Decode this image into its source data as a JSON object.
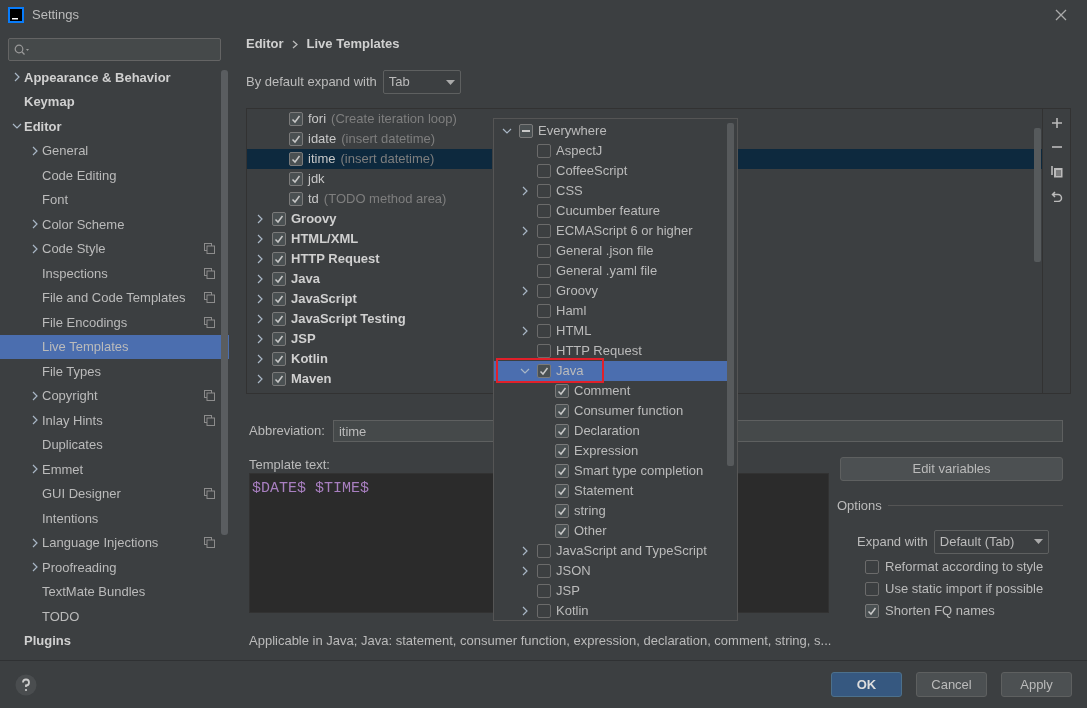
{
  "window": {
    "title": "Settings"
  },
  "sidebar": {
    "items": [
      {
        "label": "Appearance & Behavior",
        "kind": "group",
        "expanded": false,
        "selected": false,
        "project_icon": false
      },
      {
        "label": "Keymap",
        "kind": "page",
        "selected": false,
        "project_icon": false
      },
      {
        "label": "Editor",
        "kind": "group",
        "expanded": true,
        "selected": false,
        "project_icon": false,
        "children": [
          {
            "label": "General",
            "kind": "group",
            "expanded": false,
            "selected": false,
            "project_icon": false
          },
          {
            "label": "Code Editing",
            "kind": "page",
            "selected": false,
            "project_icon": false
          },
          {
            "label": "Font",
            "kind": "page",
            "selected": false,
            "project_icon": false
          },
          {
            "label": "Color Scheme",
            "kind": "group",
            "expanded": false,
            "selected": false,
            "project_icon": false
          },
          {
            "label": "Code Style",
            "kind": "group",
            "expanded": false,
            "selected": false,
            "project_icon": true
          },
          {
            "label": "Inspections",
            "kind": "page",
            "selected": false,
            "project_icon": true
          },
          {
            "label": "File and Code Templates",
            "kind": "page",
            "selected": false,
            "project_icon": true
          },
          {
            "label": "File Encodings",
            "kind": "page",
            "selected": false,
            "project_icon": true
          },
          {
            "label": "Live Templates",
            "kind": "page",
            "selected": true,
            "project_icon": false
          },
          {
            "label": "File Types",
            "kind": "page",
            "selected": false,
            "project_icon": false
          },
          {
            "label": "Copyright",
            "kind": "group",
            "expanded": false,
            "selected": false,
            "project_icon": true
          },
          {
            "label": "Inlay Hints",
            "kind": "group",
            "expanded": false,
            "selected": false,
            "project_icon": true
          },
          {
            "label": "Duplicates",
            "kind": "page",
            "selected": false,
            "project_icon": false
          },
          {
            "label": "Emmet",
            "kind": "group",
            "expanded": false,
            "selected": false,
            "project_icon": false
          },
          {
            "label": "GUI Designer",
            "kind": "page",
            "selected": false,
            "project_icon": true
          },
          {
            "label": "Intentions",
            "kind": "page",
            "selected": false,
            "project_icon": false
          },
          {
            "label": "Language Injections",
            "kind": "group",
            "expanded": false,
            "selected": false,
            "project_icon": true
          },
          {
            "label": "Proofreading",
            "kind": "group",
            "expanded": false,
            "selected": false,
            "project_icon": false
          },
          {
            "label": "TextMate Bundles",
            "kind": "page",
            "selected": false,
            "project_icon": false
          },
          {
            "label": "TODO",
            "kind": "page",
            "selected": false,
            "project_icon": false
          }
        ]
      },
      {
        "label": "Plugins",
        "kind": "page",
        "selected": false,
        "project_icon": false
      }
    ]
  },
  "breadcrumb": [
    "Editor",
    "Live Templates"
  ],
  "expand_default": {
    "label": "By default expand with",
    "value": "Tab"
  },
  "templates": [
    {
      "kind": "template",
      "name": "fori",
      "description": "(Create iteration loop)",
      "checked": true,
      "selected": false
    },
    {
      "kind": "template",
      "name": "idate",
      "description": "(insert datetime)",
      "checked": true,
      "selected": false
    },
    {
      "kind": "template",
      "name": "itime",
      "description": "(insert datetime)",
      "checked": true,
      "selected": true
    },
    {
      "kind": "template",
      "name": "jdk",
      "checked": true,
      "selected": false
    },
    {
      "kind": "template",
      "name": "td",
      "description": "(TODO method area)",
      "checked": true,
      "selected": false
    },
    {
      "kind": "group",
      "name": "Groovy",
      "expanded": false,
      "checked": true,
      "selected": false
    },
    {
      "kind": "group",
      "name": "HTML/XML",
      "expanded": false,
      "checked": true,
      "selected": false
    },
    {
      "kind": "group",
      "name": "HTTP Request",
      "expanded": false,
      "checked": true,
      "selected": false
    },
    {
      "kind": "group",
      "name": "Java",
      "expanded": false,
      "checked": true,
      "selected": false
    },
    {
      "kind": "group",
      "name": "JavaScript",
      "expanded": false,
      "checked": true,
      "selected": false
    },
    {
      "kind": "group",
      "name": "JavaScript Testing",
      "expanded": false,
      "checked": true,
      "selected": false
    },
    {
      "kind": "group",
      "name": "JSP",
      "expanded": false,
      "checked": true,
      "selected": false
    },
    {
      "kind": "group",
      "name": "Kotlin",
      "expanded": false,
      "checked": true,
      "selected": false
    },
    {
      "kind": "group",
      "name": "Maven",
      "expanded": false,
      "checked": true,
      "selected": false
    }
  ],
  "abbreviation": {
    "label": "Abbreviation:",
    "value": "itime"
  },
  "template_text": {
    "label": "Template text:",
    "value": "$DATE$ $TIME$"
  },
  "edit_variables": "Edit variables",
  "options": {
    "title": "Options",
    "expand_label": "Expand with",
    "expand_value": "Default (Tab)",
    "checks": [
      {
        "label": "Reformat according to style",
        "checked": false
      },
      {
        "label": "Use static import if possible",
        "checked": false
      },
      {
        "label": "Shorten FQ names",
        "checked": true
      }
    ]
  },
  "applicable": "Applicable in Java; Java: statement, consumer function, expression, declaration, comment, string, s...",
  "context_popup": {
    "items": [
      {
        "label": "Everywhere",
        "kind": "group",
        "expanded": true,
        "partial": true,
        "selected": false,
        "highlighted": false,
        "children": [
          {
            "label": "AspectJ",
            "kind": "leaf",
            "checked": false,
            "selected": false,
            "highlighted": false
          },
          {
            "label": "CoffeeScript",
            "kind": "leaf",
            "checked": false,
            "selected": false,
            "highlighted": false
          },
          {
            "label": "CSS",
            "kind": "group",
            "expanded": false,
            "checked": false,
            "selected": false,
            "highlighted": false
          },
          {
            "label": "Cucumber feature",
            "kind": "leaf",
            "checked": false,
            "selected": false,
            "highlighted": false
          },
          {
            "label": "ECMAScript 6 or higher",
            "kind": "group",
            "expanded": false,
            "checked": false,
            "selected": false,
            "highlighted": false
          },
          {
            "label": "General .json file",
            "kind": "leaf",
            "checked": false,
            "selected": false,
            "highlighted": false
          },
          {
            "label": "General .yaml file",
            "kind": "leaf",
            "checked": false,
            "selected": false,
            "highlighted": false
          },
          {
            "label": "Groovy",
            "kind": "group",
            "expanded": false,
            "checked": false,
            "selected": false,
            "highlighted": false
          },
          {
            "label": "Haml",
            "kind": "leaf",
            "checked": false,
            "selected": false,
            "highlighted": false
          },
          {
            "label": "HTML",
            "kind": "group",
            "expanded": false,
            "checked": false,
            "selected": false,
            "highlighted": false
          },
          {
            "label": "HTTP Request",
            "kind": "leaf",
            "checked": false,
            "selected": false,
            "highlighted": false
          },
          {
            "label": "Java",
            "kind": "group",
            "expanded": true,
            "checked": true,
            "selected": true,
            "highlighted": true,
            "children": [
              {
                "label": "Comment",
                "kind": "leaf",
                "checked": true,
                "selected": false,
                "highlighted": false
              },
              {
                "label": "Consumer function",
                "kind": "leaf",
                "checked": true,
                "selected": false,
                "highlighted": false
              },
              {
                "label": "Declaration",
                "kind": "leaf",
                "checked": true,
                "selected": false,
                "highlighted": false
              },
              {
                "label": "Expression",
                "kind": "leaf",
                "checked": true,
                "selected": false,
                "highlighted": false
              },
              {
                "label": "Smart type completion",
                "kind": "leaf",
                "checked": true,
                "selected": false,
                "highlighted": false
              },
              {
                "label": "Statement",
                "kind": "leaf",
                "checked": true,
                "selected": false,
                "highlighted": false
              },
              {
                "label": "string",
                "kind": "leaf",
                "checked": true,
                "selected": false,
                "highlighted": false
              },
              {
                "label": "Other",
                "kind": "leaf",
                "checked": true,
                "selected": false,
                "highlighted": false
              }
            ]
          },
          {
            "label": "JavaScript and TypeScript",
            "kind": "group",
            "expanded": false,
            "checked": false,
            "selected": false,
            "highlighted": false
          },
          {
            "label": "JSON",
            "kind": "group",
            "expanded": false,
            "checked": false,
            "selected": false,
            "highlighted": false
          },
          {
            "label": "JSP",
            "kind": "leaf",
            "checked": false,
            "selected": false,
            "highlighted": false
          },
          {
            "label": "Kotlin",
            "kind": "group",
            "expanded": false,
            "checked": false,
            "selected": false,
            "highlighted": false
          }
        ]
      }
    ]
  },
  "buttons": [
    {
      "label": "OK",
      "kind": "primary"
    },
    {
      "label": "Cancel",
      "kind": "secondary"
    },
    {
      "label": "Apply",
      "kind": "secondary"
    }
  ]
}
